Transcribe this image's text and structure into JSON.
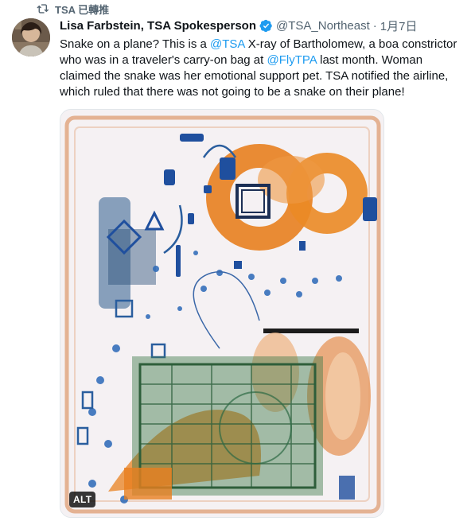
{
  "retweet": {
    "label": "TSA 已轉推",
    "icon": "retweet-icon"
  },
  "tweet": {
    "author": {
      "display_name": "Lisa Farbstein, TSA Spokesperson",
      "verified": true,
      "handle": "@TSA_Northeast",
      "separator": "·",
      "date": "1月7日",
      "avatar_icon": "avatar"
    },
    "text_segments": [
      {
        "t": "Snake on a plane? This is a ",
        "mention": false
      },
      {
        "t": "@TSA",
        "mention": true
      },
      {
        "t": " X-ray of Bartholomew, a boa constrictor who was in a traveler's carry-on bag at ",
        "mention": false
      },
      {
        "t": "@FlyTPA",
        "mention": true
      },
      {
        "t": " last month. Woman claimed the snake was her emotional support pet. TSA notified the airline, which ruled that there was not going to be a snake on their plane!",
        "mention": false
      }
    ],
    "media": {
      "alt_badge": "ALT"
    }
  },
  "colors": {
    "link": "#1d9bf0",
    "secondary_text": "#536471",
    "verified_badge": "#1d9bf0",
    "xray_orange": "#e8801f",
    "xray_blue": "#1f4f9e",
    "xray_green": "#3f7a4a"
  }
}
